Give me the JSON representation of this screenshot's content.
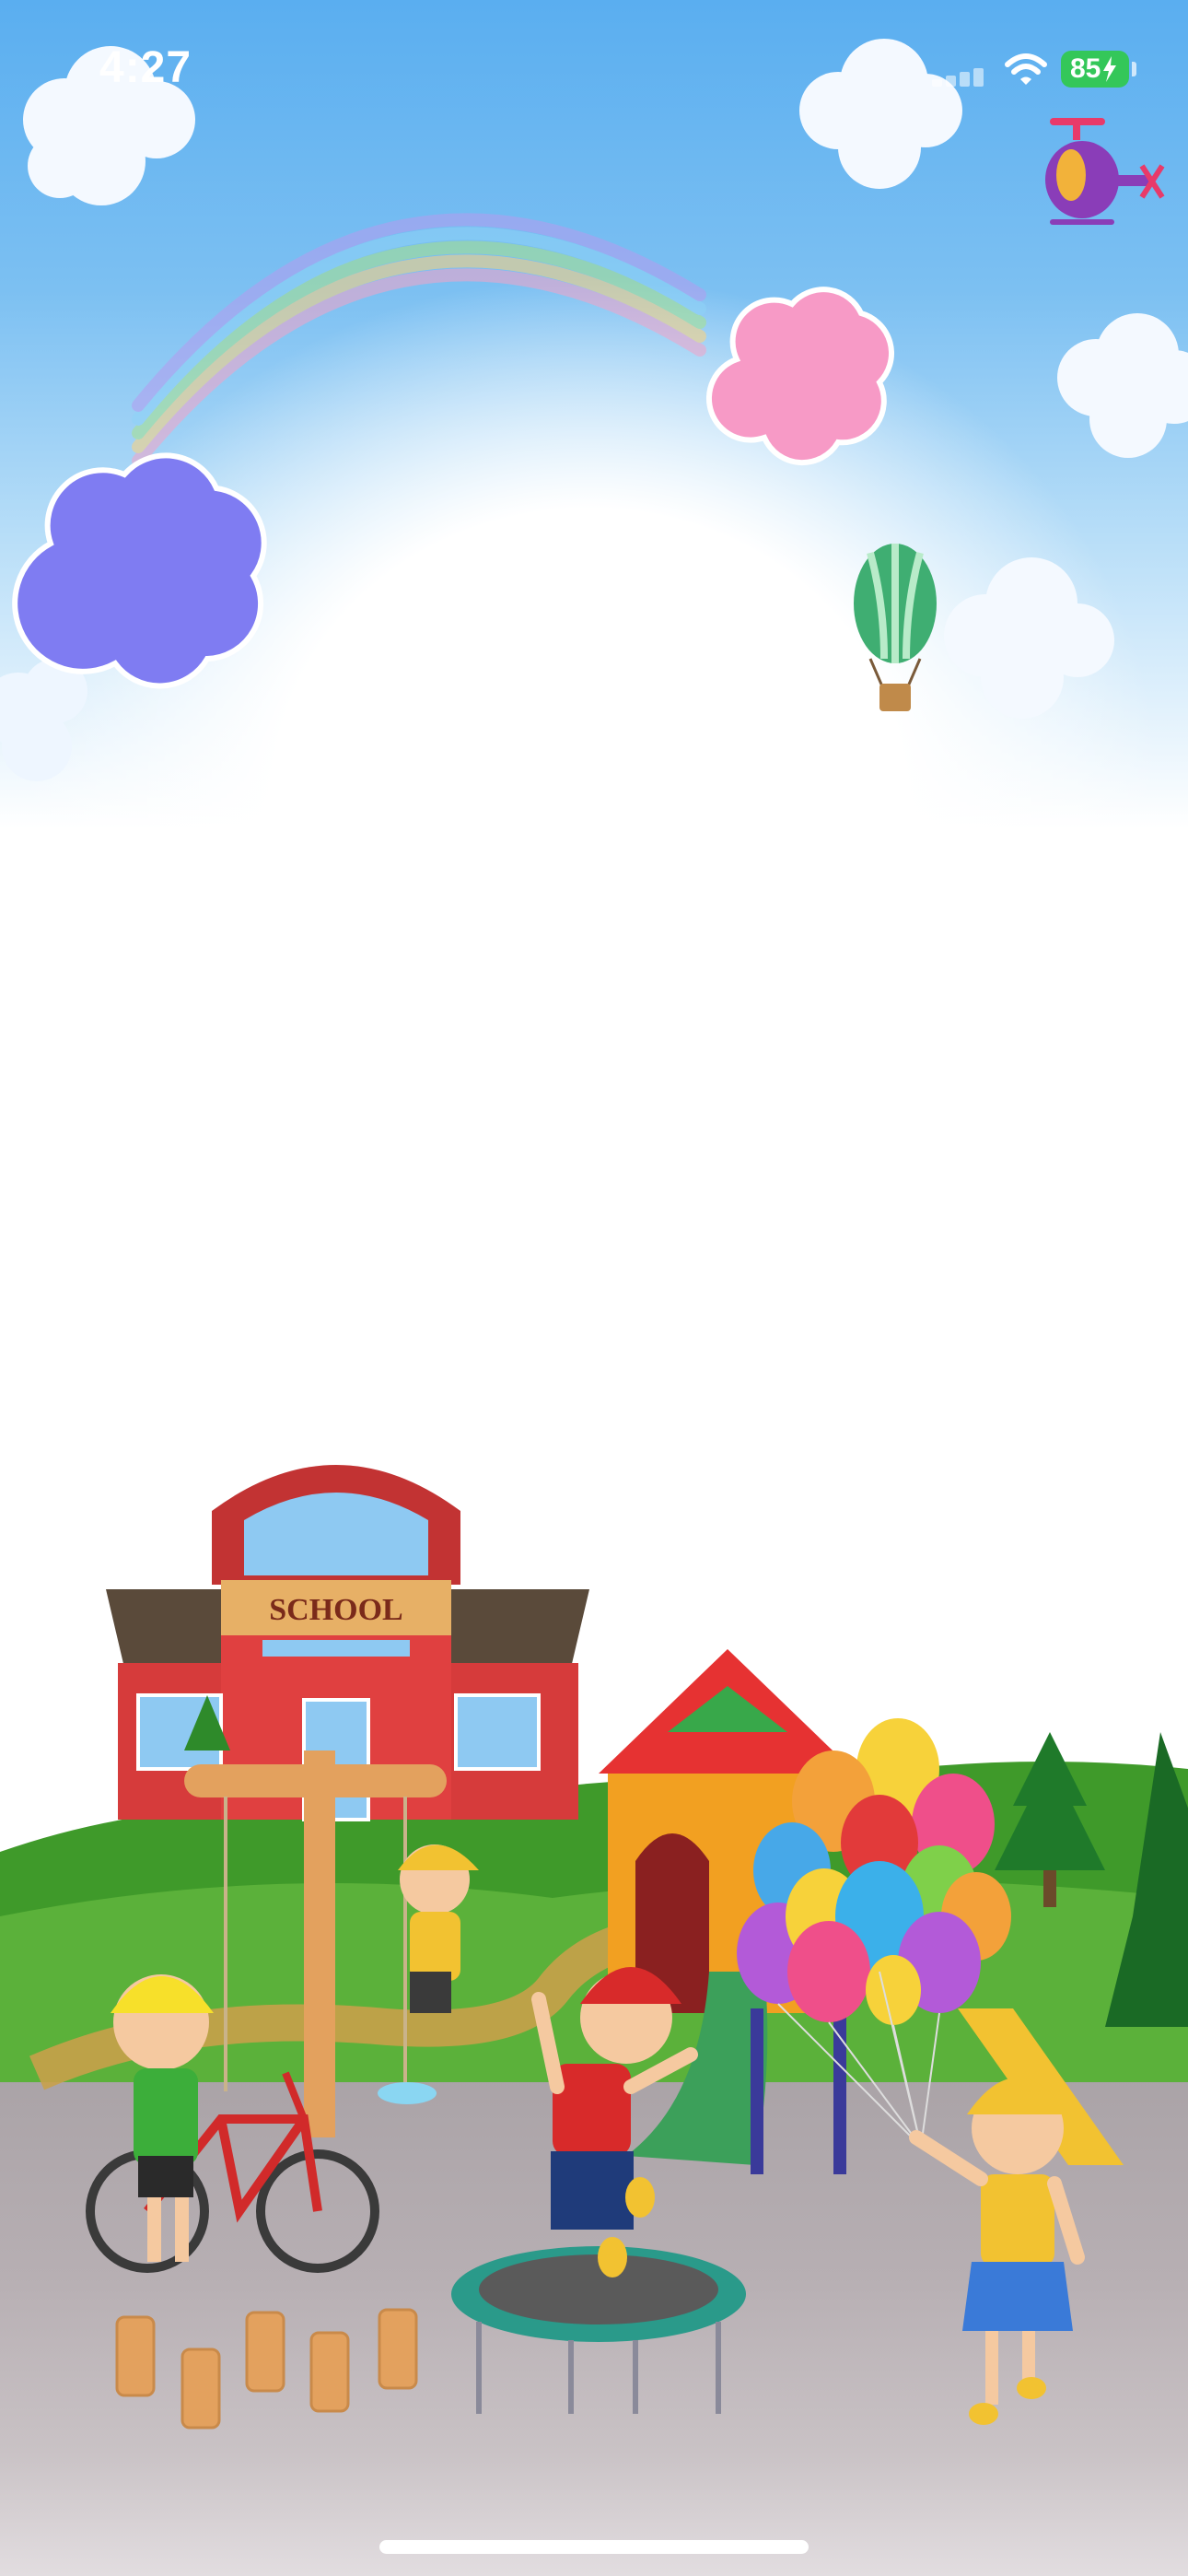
{
  "status_bar": {
    "time": "4:27",
    "battery_level": 85,
    "battery_label": "85",
    "battery_color": "#34c759",
    "wifi_icon": "wifi-icon",
    "signal_icon": "cellular-signal-icon",
    "charging_icon": "bolt-icon"
  },
  "scene": {
    "school_sign": "SCHOOL",
    "sky_color": "#5aaef0",
    "grass_color": "#3f9a2a",
    "ground_color": "#b3abaf"
  },
  "home_indicator": "home-indicator"
}
